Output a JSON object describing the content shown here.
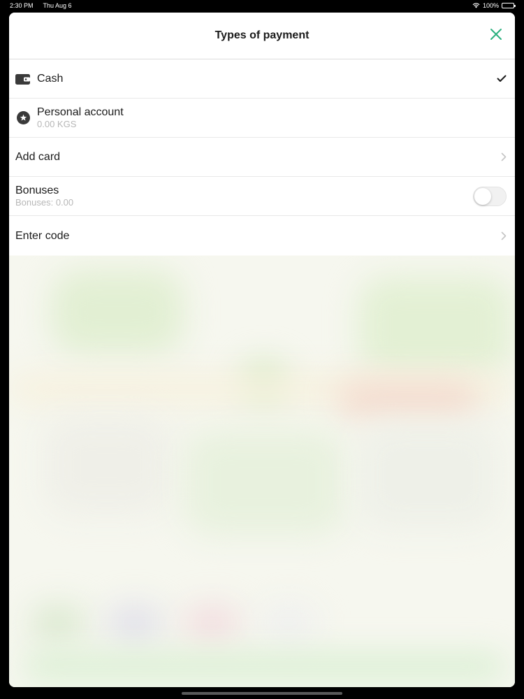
{
  "status_bar": {
    "time": "2:30 PM",
    "date": "Thu Aug 6",
    "battery": "100%"
  },
  "header": {
    "title": "Types of payment"
  },
  "payment_methods": {
    "cash": {
      "label": "Cash",
      "selected": true
    },
    "personal_account": {
      "label": "Personal account",
      "balance": "0.00 KGS"
    },
    "add_card": {
      "label": "Add card"
    },
    "bonuses": {
      "label": "Bonuses",
      "balance": "Bonuses: 0.00",
      "enabled": false
    },
    "enter_code": {
      "label": "Enter code"
    }
  },
  "colors": {
    "accent": "#2bb07f",
    "text_primary": "#1b1b1b",
    "text_secondary": "#b7b7b7"
  },
  "icons": {
    "close": "close-icon",
    "cash": "wallet-icon",
    "personal_account": "star-icon",
    "selected": "check-icon",
    "disclosure": "chevron-right-icon"
  }
}
